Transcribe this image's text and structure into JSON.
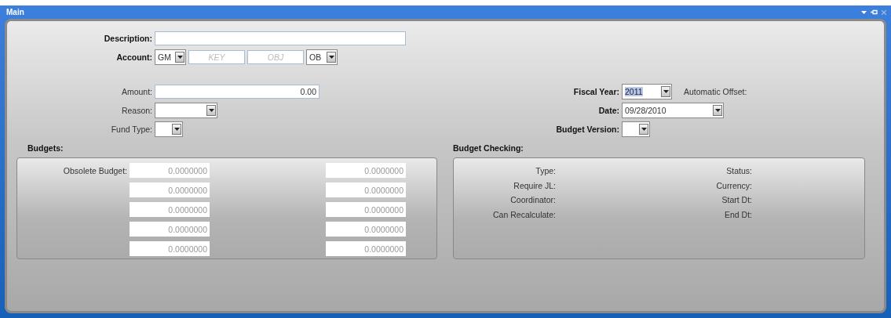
{
  "window": {
    "title": "Main"
  },
  "form": {
    "description": {
      "label": "Description:",
      "bold": true
    },
    "account": {
      "label": "Account:",
      "bold": true,
      "segments": [
        {
          "kind": "select",
          "value": "GM"
        },
        {
          "kind": "input",
          "placeholder": "KEY"
        },
        {
          "kind": "input",
          "placeholder": "OBJ"
        },
        {
          "kind": "select",
          "value": "OB"
        }
      ]
    },
    "left_fields": [
      {
        "label": "Amount:",
        "bold": false,
        "kind": "input",
        "value": "0.00"
      },
      {
        "label": "Reason:",
        "bold": false,
        "kind": "select"
      },
      {
        "label": "Fund Type:",
        "bold": false,
        "kind": "small-select"
      }
    ],
    "right_fields": [
      {
        "label": "Fiscal Year:",
        "bold": true,
        "kind": "select",
        "value": "2011",
        "highlighted": true
      },
      {
        "label": "Date:",
        "bold": true,
        "kind": "date",
        "value": "09/28/2010",
        "highlighted": false
      },
      {
        "label": "Budget Version:",
        "bold": true,
        "kind": "small-select",
        "highlighted": false
      }
    ],
    "automatic_offset": {
      "label": "Automatic Offset:"
    }
  },
  "budgets": {
    "heading": "Budgets:",
    "rows": [
      {
        "label": "Obsolete Budget:",
        "values": [
          "0.0000000",
          "0.0000000"
        ]
      },
      {
        "values": [
          "0.0000000",
          "0.0000000"
        ]
      },
      {
        "values": [
          "0.0000000",
          "0.0000000"
        ]
      },
      {
        "values": [
          "0.0000000",
          "0.0000000"
        ]
      },
      {
        "values": [
          "0.0000000",
          "0.0000000"
        ]
      }
    ]
  },
  "budget_checking": {
    "heading": "Budget Checking:",
    "left_labels": [
      "Type:",
      "Require JL:",
      "Coordinator:",
      "Can Recalculate:"
    ],
    "right_labels": [
      "Status:",
      "Currency:",
      "Start Dt:",
      "End Dt:"
    ]
  }
}
